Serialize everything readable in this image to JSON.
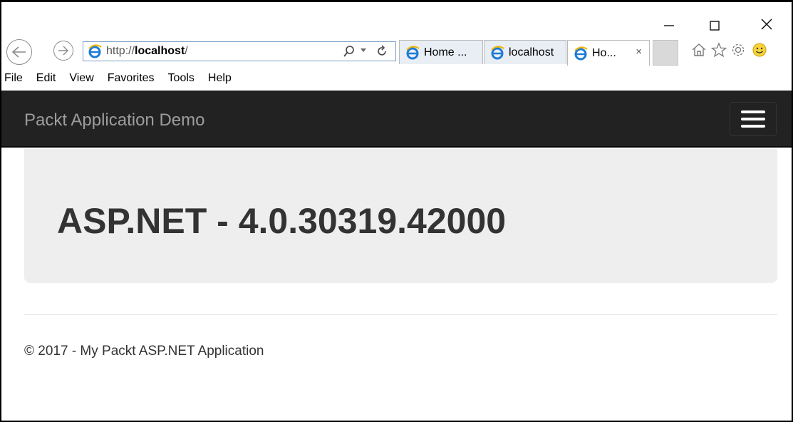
{
  "browser": {
    "address": {
      "url_prefix": "http://",
      "url_host": "localhost",
      "url_suffix": "/"
    },
    "tabs": [
      {
        "label": "Home ..."
      },
      {
        "label": "localhost"
      },
      {
        "label": "Ho...",
        "close": "×"
      }
    ],
    "menu": [
      "File",
      "Edit",
      "View",
      "Favorites",
      "Tools",
      "Help"
    ],
    "icons": {
      "back": "back-arrow-icon",
      "forward": "forward-arrow-icon",
      "search": "search-icon",
      "refresh": "refresh-icon",
      "home": "home-icon",
      "favorites": "star-icon",
      "settings": "gear-icon",
      "feedback": "smiley-icon"
    }
  },
  "page": {
    "brand": "Packt Application Demo",
    "jumbotron_title": "ASP.NET - 4.0.30319.42000",
    "footer": "© 2017 - My Packt ASP.NET Application"
  },
  "colors": {
    "navbar_bg": "#222222",
    "brand_text": "#9d9d9d",
    "jumbotron_bg": "#eeeeee",
    "ie_blue": "#1e7bd6"
  }
}
